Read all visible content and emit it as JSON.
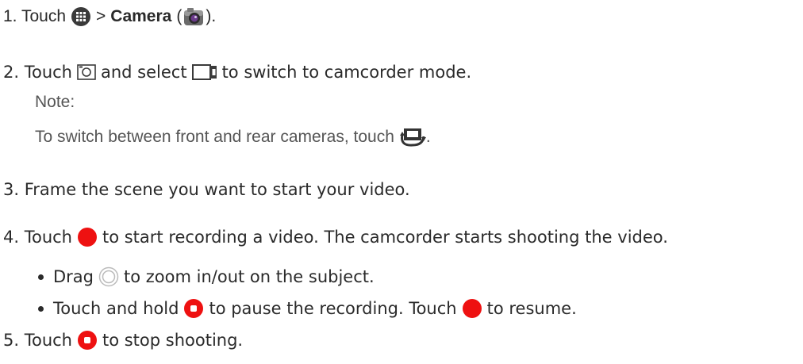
{
  "steps": {
    "s1": {
      "prefix": "1. Touch",
      "sep": ">",
      "camera_label": "Camera",
      "paren_open": "(",
      "paren_close": ")."
    },
    "s2": {
      "prefix": "2. Touch",
      "mid": "and select",
      "suffix": "to switch to camcorder mode."
    },
    "note": {
      "label": "Note:",
      "text": "To switch between front and rear cameras, touch",
      "end": "."
    },
    "s3": {
      "text": "3. Frame the scene you want to start your video."
    },
    "s4": {
      "prefix": "4. Touch",
      "suffix": "to start recording a video. The camcorder starts shooting the video."
    },
    "b1": {
      "prefix": "Drag",
      "suffix": "to zoom in/out on the subject."
    },
    "b2": {
      "prefix": "Touch and hold",
      "mid": "to pause the recording. Touch",
      "suffix": "to resume."
    },
    "s5": {
      "prefix": "5. Touch",
      "suffix": "to stop shooting."
    }
  },
  "icons": {
    "apps": "apps-icon",
    "camera_app": "camera-app-icon",
    "camera_mode": "camera-mode-icon",
    "camcorder_mode": "camcorder-mode-icon",
    "swap_camera": "swap-camera-icon",
    "record": "record-icon",
    "zoom": "zoom-icon",
    "stop": "stop-icon"
  },
  "colors": {
    "record_red": "#ee1111",
    "text": "#2a2a2a",
    "note": "#555555"
  }
}
